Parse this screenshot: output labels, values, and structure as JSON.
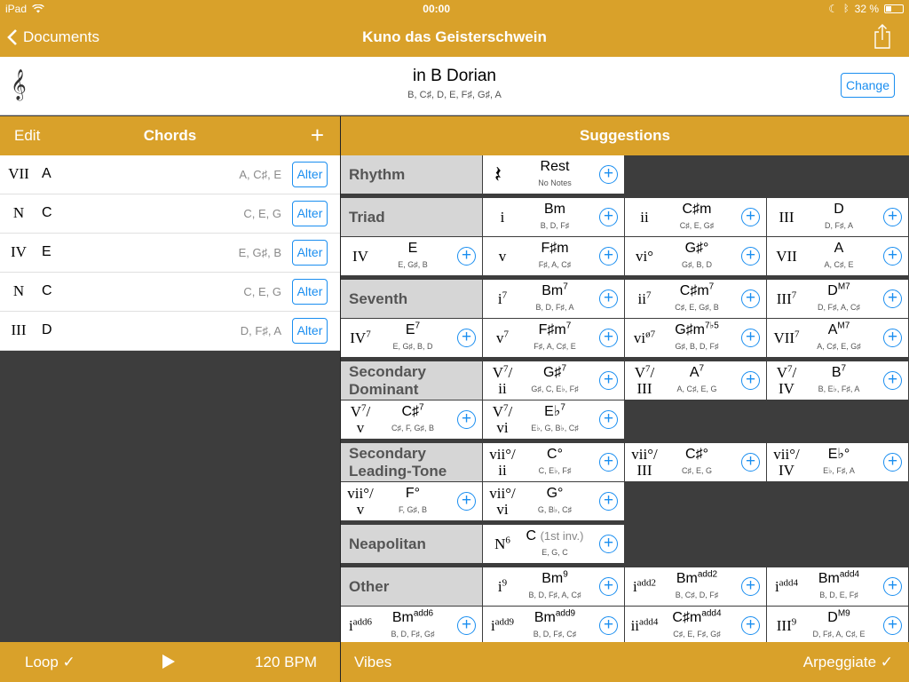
{
  "status": {
    "carrier": "iPad",
    "time": "00:00",
    "battery": "32 %"
  },
  "nav": {
    "back": "Documents",
    "title": "Kuno das Geisterschwein"
  },
  "key": {
    "clef": "𝄞",
    "mode": "in B Dorian",
    "notes": "B, C♯, D, E, F♯, G♯, A",
    "change": "Change"
  },
  "chords_panel": {
    "edit": "Edit",
    "title": "Chords",
    "plus": "+",
    "items": [
      {
        "numeral": "VII",
        "name": "A",
        "notes": "A, C♯, E",
        "alter": "Alter"
      },
      {
        "numeral": "N",
        "name": "C",
        "notes": "C, E, G",
        "alter": "Alter"
      },
      {
        "numeral": "IV",
        "name": "E",
        "notes": "E, G♯, B",
        "alter": "Alter"
      },
      {
        "numeral": "N",
        "name": "C",
        "notes": "C, E, G",
        "alter": "Alter"
      },
      {
        "numeral": "III",
        "name": "D",
        "notes": "D, F♯, A",
        "alter": "Alter"
      }
    ],
    "loop": "Loop ✓",
    "bpm": "120 BPM"
  },
  "suggestions": {
    "title": "Suggestions",
    "vibes": "Vibes",
    "arpeggiate": "Arpeggiate ✓",
    "sections": [
      {
        "label": "Rhythm",
        "cells": [
          {
            "rn": "",
            "rn_sup": "",
            "rn2": "",
            "name": "Rest",
            "sup": "",
            "inv": "",
            "notes": "No Notes",
            "rest": true
          }
        ]
      },
      {
        "label": "Triad",
        "cells": [
          {
            "rn": "i",
            "rn_sup": "",
            "rn2": "",
            "name": "Bm",
            "sup": "",
            "inv": "",
            "notes": "B, D, F♯"
          },
          {
            "rn": "ii",
            "rn_sup": "",
            "rn2": "",
            "name": "C♯m",
            "sup": "",
            "inv": "",
            "notes": "C♯, E, G♯"
          },
          {
            "rn": "III",
            "rn_sup": "",
            "rn2": "",
            "name": "D",
            "sup": "",
            "inv": "",
            "notes": "D, F♯, A"
          },
          {
            "rn": "IV",
            "rn_sup": "",
            "rn2": "",
            "name": "E",
            "sup": "",
            "inv": "",
            "notes": "E, G♯, B"
          },
          {
            "rn": "v",
            "rn_sup": "",
            "rn2": "",
            "name": "F♯m",
            "sup": "",
            "inv": "",
            "notes": "F♯, A, C♯"
          },
          {
            "rn": "vi°",
            "rn_sup": "",
            "rn2": "",
            "name": "G♯°",
            "sup": "",
            "inv": "",
            "notes": "G♯, B, D"
          },
          {
            "rn": "VII",
            "rn_sup": "",
            "rn2": "",
            "name": "A",
            "sup": "",
            "inv": "",
            "notes": "A, C♯, E"
          }
        ]
      },
      {
        "label": "Seventh",
        "cells": [
          {
            "rn": "i",
            "rn_sup": "7",
            "rn2": "",
            "name": "Bm",
            "sup": "7",
            "inv": "",
            "notes": "B, D, F♯, A"
          },
          {
            "rn": "ii",
            "rn_sup": "7",
            "rn2": "",
            "name": "C♯m",
            "sup": "7",
            "inv": "",
            "notes": "C♯, E, G♯, B"
          },
          {
            "rn": "III",
            "rn_sup": "7",
            "rn2": "",
            "name": "D",
            "sup": "M7",
            "inv": "",
            "notes": "D, F♯, A, C♯"
          },
          {
            "rn": "IV",
            "rn_sup": "7",
            "rn2": "",
            "name": "E",
            "sup": "7",
            "inv": "",
            "notes": "E, G♯, B, D"
          },
          {
            "rn": "v",
            "rn_sup": "7",
            "rn2": "",
            "name": "F♯m",
            "sup": "7",
            "inv": "",
            "notes": "F♯, A, C♯, E"
          },
          {
            "rn": "vi",
            "rn_sup": "ø7",
            "rn2": "",
            "name": "G♯m",
            "sup": "7♭5",
            "inv": "",
            "notes": "G♯, B, D, F♯"
          },
          {
            "rn": "VII",
            "rn_sup": "7",
            "rn2": "",
            "name": "A",
            "sup": "M7",
            "inv": "",
            "notes": "A, C♯, E, G♯"
          }
        ]
      },
      {
        "label": "Secondary Dominant",
        "cells": [
          {
            "rn": "V",
            "rn_sup": "7",
            "rn2": "ii",
            "name": "G♯",
            "sup": "7",
            "inv": "",
            "notes": "G♯, C, E♭, F♯"
          },
          {
            "rn": "V",
            "rn_sup": "7",
            "rn2": "III",
            "name": "A",
            "sup": "7",
            "inv": "",
            "notes": "A, C♯, E, G"
          },
          {
            "rn": "V",
            "rn_sup": "7",
            "rn2": "IV",
            "name": "B",
            "sup": "7",
            "inv": "",
            "notes": "B, E♭, F♯, A"
          },
          {
            "rn": "V",
            "rn_sup": "7",
            "rn2": "v",
            "name": "C♯",
            "sup": "7",
            "inv": "",
            "notes": "C♯, F, G♯, B"
          },
          {
            "rn": "V",
            "rn_sup": "7",
            "rn2": "vi",
            "name": "E♭",
            "sup": "7",
            "inv": "",
            "notes": "E♭, G, B♭, C♯"
          }
        ]
      },
      {
        "label": "Secondary Leading-Tone",
        "cells": [
          {
            "rn": "vii°",
            "rn_sup": "",
            "rn2": "ii",
            "name": "C°",
            "sup": "",
            "inv": "",
            "notes": "C, E♭, F♯"
          },
          {
            "rn": "vii°",
            "rn_sup": "",
            "rn2": "III",
            "name": "C♯°",
            "sup": "",
            "inv": "",
            "notes": "C♯, E, G"
          },
          {
            "rn": "vii°",
            "rn_sup": "",
            "rn2": "IV",
            "name": "E♭°",
            "sup": "",
            "inv": "",
            "notes": "E♭, F♯, A"
          },
          {
            "rn": "vii°",
            "rn_sup": "",
            "rn2": "v",
            "name": "F°",
            "sup": "",
            "inv": "",
            "notes": "F, G♯, B"
          },
          {
            "rn": "vii°",
            "rn_sup": "",
            "rn2": "vi",
            "name": "G°",
            "sup": "",
            "inv": "",
            "notes": "G, B♭, C♯"
          }
        ]
      },
      {
        "label": "Neapolitan",
        "cells": [
          {
            "rn": "N",
            "rn_sup": "6",
            "rn2": "",
            "name": "C",
            "sup": "",
            "inv": "(1st inv.)",
            "notes": "E, G, C"
          }
        ]
      },
      {
        "label": "Other",
        "cells": [
          {
            "rn": "i",
            "rn_sup": "9",
            "rn2": "",
            "name": "Bm",
            "sup": "9",
            "inv": "",
            "notes": "B, D, F♯, A, C♯"
          },
          {
            "rn": "i",
            "rn_sup": "add2",
            "rn2": "",
            "name": "Bm",
            "sup": "add2",
            "inv": "",
            "notes": "B, C♯, D, F♯"
          },
          {
            "rn": "i",
            "rn_sup": "add4",
            "rn2": "",
            "name": "Bm",
            "sup": "add4",
            "inv": "",
            "notes": "B, D, E, F♯"
          },
          {
            "rn": "i",
            "rn_sup": "add6",
            "rn2": "",
            "name": "Bm",
            "sup": "add6",
            "inv": "",
            "notes": "B, D, F♯, G♯"
          },
          {
            "rn": "i",
            "rn_sup": "add9",
            "rn2": "",
            "name": "Bm",
            "sup": "add9",
            "inv": "",
            "notes": "B, D, F♯, C♯"
          },
          {
            "rn": "ii",
            "rn_sup": "add4",
            "rn2": "",
            "name": "C♯m",
            "sup": "add4",
            "inv": "",
            "notes": "C♯, E, F♯, G♯"
          },
          {
            "rn": "III",
            "rn_sup": "9",
            "rn2": "",
            "name": "D",
            "sup": "M9",
            "inv": "",
            "notes": "D, F♯, A, C♯, E"
          }
        ]
      }
    ]
  },
  "colors": {
    "accent": "#d9a12a",
    "link": "#1a8ef0",
    "dark": "#3d3d3d",
    "section_bg": "#d6d6d6"
  },
  "icons": {
    "back": "chevron-left-icon",
    "share": "share-icon",
    "add": "plus-circle-icon",
    "play": "play-icon"
  }
}
